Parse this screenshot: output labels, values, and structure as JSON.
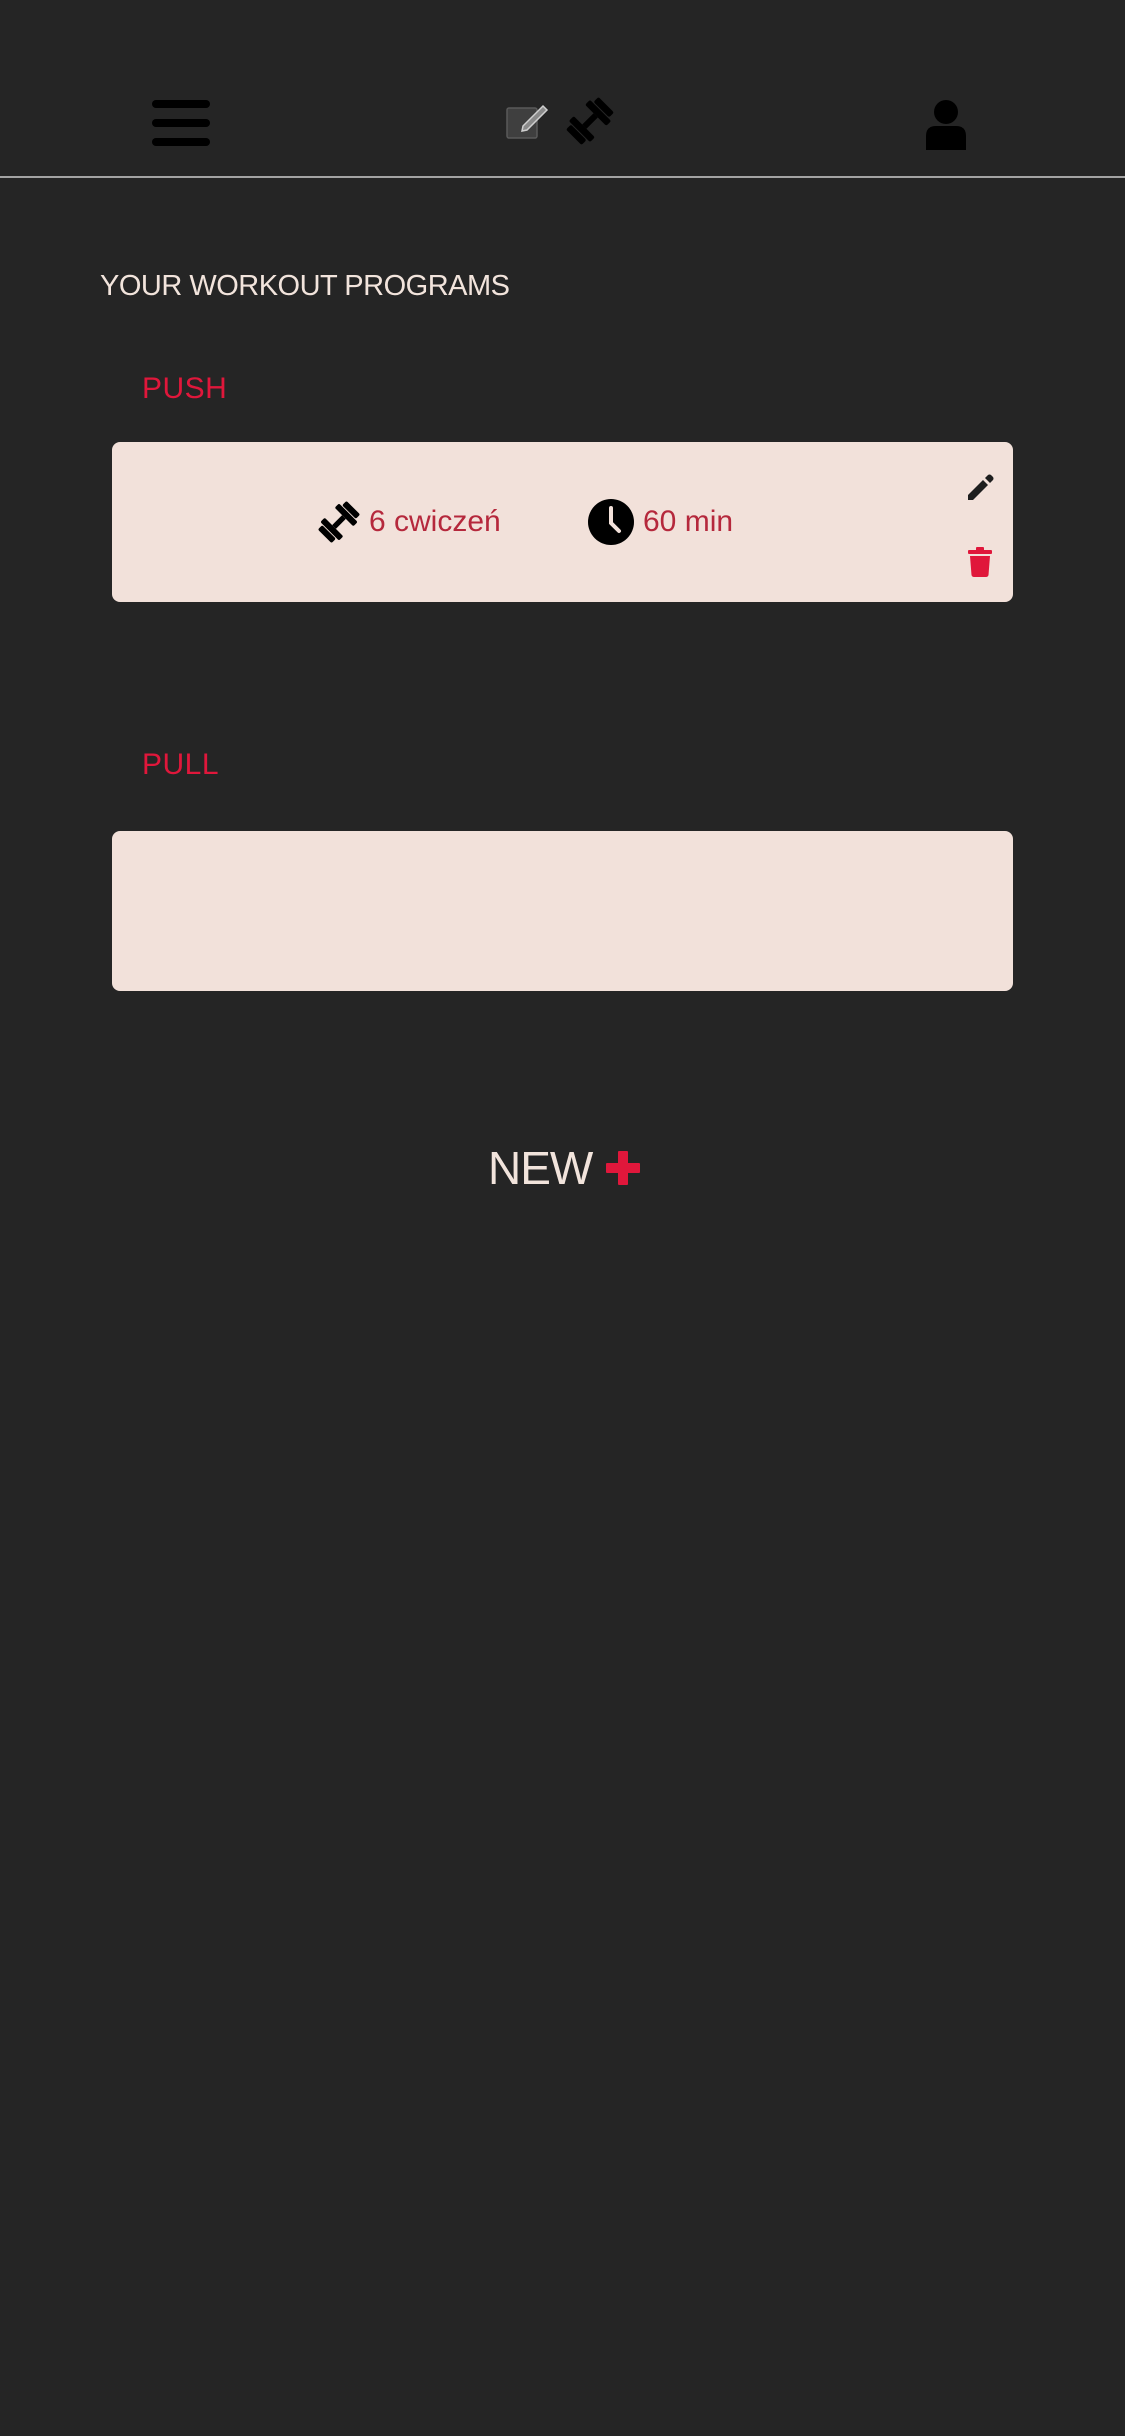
{
  "header": {
    "menu_icon": "hamburger-menu-icon",
    "center_icons": [
      "edit-note-icon",
      "dumbbell-icon"
    ],
    "profile_icon": "user-icon"
  },
  "main": {
    "title": "YOUR WORKOUT PROGRAMS",
    "programs": [
      {
        "name": "PUSH",
        "exercises": "6 cwiczeń",
        "duration": "60 min",
        "actions": [
          "edit-icon",
          "trash-icon"
        ]
      },
      {
        "name": "PULL"
      }
    ],
    "new_label": "NEW",
    "new_icon": "plus-icon"
  },
  "colors": {
    "background": "#252525",
    "accent": "#e0173b",
    "card": "#f2e1da",
    "stat_text": "#b5283c",
    "light_text": "#f2e4dc"
  }
}
